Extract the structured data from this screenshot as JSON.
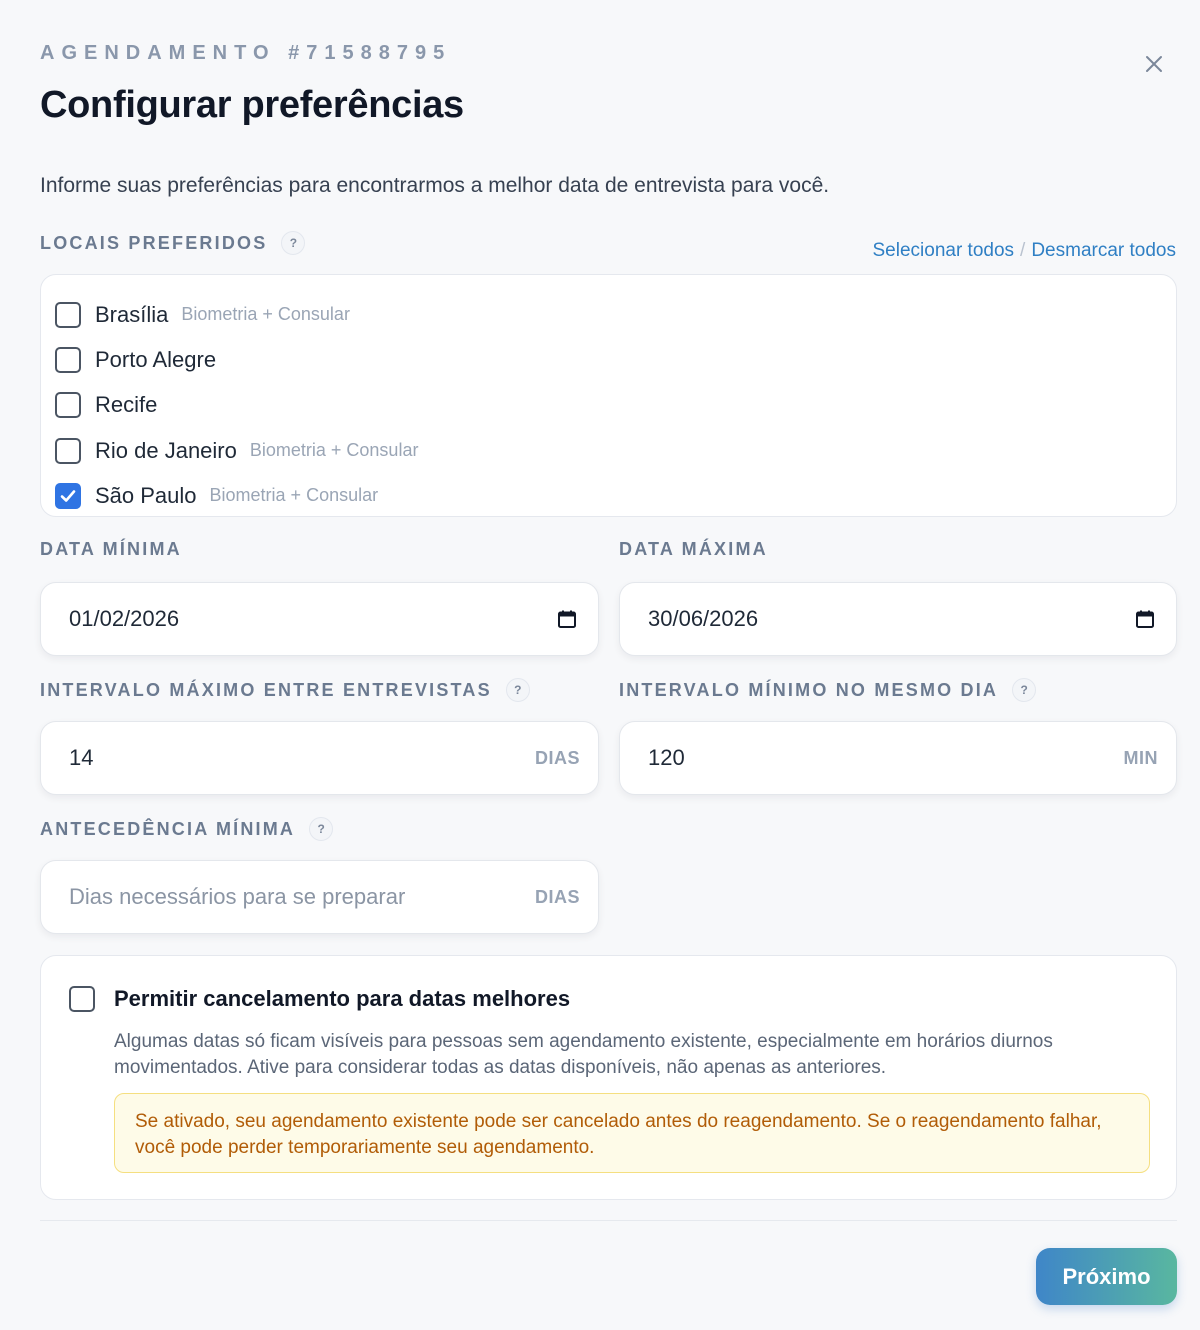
{
  "header": {
    "eyebrow": "AGENDAMENTO #71588795",
    "title": "Configurar preferências",
    "intro": "Informe suas preferências para encontrarmos a melhor data de entrevista para você."
  },
  "locations": {
    "label": "LOCAIS PREFERIDOS",
    "help": "?",
    "select_all": "Selecionar todos",
    "separator": "/",
    "deselect_all": "Desmarcar todos",
    "items": [
      {
        "name": "Brasília",
        "tag": "Biometria + Consular",
        "checked": false
      },
      {
        "name": "Porto Alegre",
        "tag": "",
        "checked": false
      },
      {
        "name": "Recife",
        "tag": "",
        "checked": false
      },
      {
        "name": "Rio de Janeiro",
        "tag": "Biometria + Consular",
        "checked": false
      },
      {
        "name": "São Paulo",
        "tag": "Biometria + Consular",
        "checked": true
      }
    ]
  },
  "dates": {
    "min_label": "DATA MÍNIMA",
    "min_value": "01/02/2026",
    "max_label": "DATA MÁXIMA",
    "max_value": "30/06/2026"
  },
  "intervals": {
    "max_between_label": "INTERVALO MÁXIMO ENTRE ENTREVISTAS",
    "max_between_value": "14",
    "max_between_unit": "DIAS",
    "min_same_day_label": "INTERVALO MÍNIMO NO MESMO DIA",
    "min_same_day_value": "120",
    "min_same_day_unit": "MIN",
    "help": "?"
  },
  "advance": {
    "label": "ANTECEDÊNCIA MÍNIMA",
    "placeholder": "Dias necessários para se preparar",
    "unit": "DIAS",
    "help": "?"
  },
  "cancellation": {
    "checked": false,
    "title": "Permitir cancelamento para datas melhores",
    "description": "Algumas datas só ficam visíveis para pessoas sem agendamento existente, especialmente em horários diurnos movimentados. Ative para considerar todas as datas disponíveis, não apenas as anteriores.",
    "warning": "Se ativado, seu agendamento existente pode ser cancelado antes do reagendamento. Se o reagendamento falhar, você pode perder temporariamente seu agendamento."
  },
  "footer": {
    "next_label": "Próximo"
  },
  "icons": {
    "close": "close-icon",
    "calendar": "calendar-icon",
    "check": "checkmark-icon"
  },
  "colors": {
    "accent": "#2f74e3",
    "link": "#2f7fc4",
    "button_gradient_start": "#3f86c8",
    "button_gradient_end": "#59b7a0",
    "warning_text": "#b15c07",
    "warning_bg": "#fefbe8"
  }
}
